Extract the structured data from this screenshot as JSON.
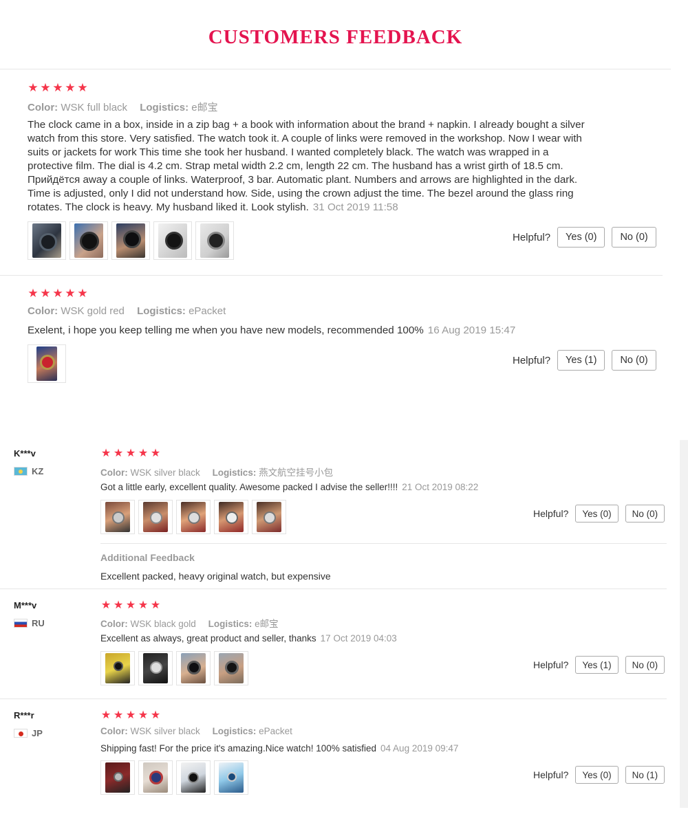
{
  "page": {
    "title": "CUSTOMERS FEEDBACK",
    "colors": {
      "title": "#e4144f",
      "star": "#f5354a",
      "muted": "#999999"
    }
  },
  "labels": {
    "color": "Color:",
    "logistics": "Logistics:",
    "helpful": "Helpful?",
    "additional_feedback": "Additional Feedback"
  },
  "reviews": [
    {
      "stars": 5,
      "color": "WSK full black",
      "logistics": "e邮宝",
      "text": "The clock came in a box, inside in a zip bag + a book with information about the brand + napkin. I already bought a silver watch from this store. Very satisfied. The watch took it. A couple of links were removed in the workshop. Now I wear with suits or jackets for work This time she took her husband. I wanted completely black. The watch was wrapped in a protective film. The dial is 4.2 cm. Strap metal width 2.2 cm, length 22 cm. The husband has a wrist girth of 18.5 cm. Прийдётся away a couple of links. Waterproof, 3 bar. Automatic plant. Numbers and arrows are highlighted in the dark. Time is adjusted, only I did not understand how. Side, using the crown adjust the time. The bezel around the glass ring rotates. The clock is heavy. My husband liked it. Look stylish.",
      "date": "31 Oct 2019 11:58",
      "yes": "Yes (0)",
      "no": "No (0)",
      "photos": [
        "watch-photo",
        "watch-photo",
        "watch-photo",
        "watch-photo",
        "watch-photo"
      ]
    },
    {
      "stars": 5,
      "color": "WSK gold red",
      "logistics": "ePacket",
      "text": "Exelent, i hope you keep telling me when you have new models, recommended 100%",
      "date": "16 Aug 2019 15:47",
      "yes": "Yes (1)",
      "no": "No (0)",
      "photos": [
        "watch-photo"
      ]
    },
    {
      "user": "K***v",
      "country": "KZ",
      "stars": 5,
      "color": "WSK silver black",
      "logistics": "燕文航空挂号小包",
      "text": "Got a little early, excellent quality. Awesome packed I advise the seller!!!!",
      "date": "21 Oct 2019 08:22",
      "yes": "Yes (0)",
      "no": "No (0)",
      "photos": [
        "watch-photo",
        "watch-photo",
        "watch-photo",
        "watch-photo",
        "watch-photo"
      ],
      "additional_feedback": "Excellent packed, heavy original watch, but expensive"
    },
    {
      "user": "M***v",
      "country": "RU",
      "stars": 5,
      "color": "WSK black gold",
      "logistics": "e邮宝",
      "text": "Excellent as always, great product and seller, thanks",
      "date": "17 Oct 2019 04:03",
      "yes": "Yes (1)",
      "no": "No (0)",
      "photos": [
        "watch-photo",
        "watch-photo",
        "watch-photo",
        "watch-photo"
      ]
    },
    {
      "user": "R***r",
      "country": "JP",
      "stars": 5,
      "color": "WSK silver black",
      "logistics": "ePacket",
      "text": "Shipping fast! For the price it's amazing.Nice watch! 100% satisfied",
      "date": "04 Aug 2019 09:47",
      "yes": "Yes (0)",
      "no": "No (1)",
      "photos": [
        "watch-photo",
        "watch-photo",
        "watch-photo",
        "watch-photo"
      ]
    }
  ]
}
